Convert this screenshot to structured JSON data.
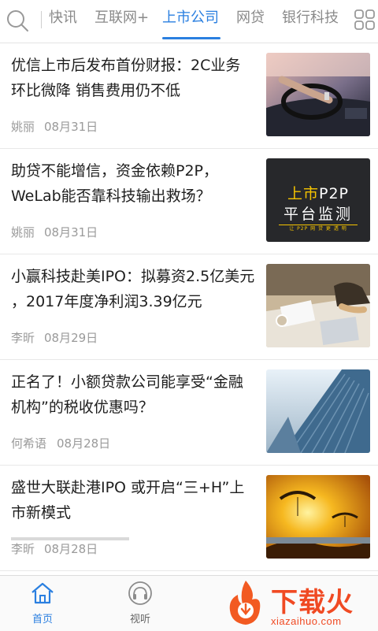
{
  "nav": {
    "tabs": [
      {
        "label": "快讯"
      },
      {
        "label": "互联网+"
      },
      {
        "label": "上市公司",
        "active": true
      },
      {
        "label": "网贷"
      },
      {
        "label": "银行科技"
      }
    ],
    "accent_color": "#2a7fe0",
    "search_icon": "search-icon",
    "more_icon": "grid-icon"
  },
  "articles": [
    {
      "title": "优信上市后发布首份财报：2C业务环比微降 销售费用仍不低",
      "author": "姚丽",
      "date": "08月31日",
      "thumb": "car-dashboard"
    },
    {
      "title": "助贷不能增信，资金依赖P2P，WeLab能否靠科技输出救场？",
      "author": "姚丽",
      "date": "08月31日",
      "thumb": "text-graphic",
      "thumb_text": {
        "highlight": "上市",
        "line1_rest": "P2P",
        "line2": "平台监测",
        "footer": "让 P2P 网 贷 更 透 明"
      }
    },
    {
      "title": "小赢科技赴美IPO：拟募资2.5亿美元 ，2017年度净利润3.39亿元",
      "author": "李昕",
      "date": "08月29日",
      "thumb": "office-desk"
    },
    {
      "title": "正名了！小额贷款公司能享受“金融机构”的税收优惠吗？",
      "author": "何希语",
      "date": "08月28日",
      "thumb": "skyscraper"
    },
    {
      "title": "盛世大联赴港IPO  或开启“三+H”上市新模式",
      "author": "李昕",
      "date": "08月28日",
      "thumb": "paragliders-sunset"
    }
  ],
  "bottom_nav": {
    "home_label": "首页",
    "listen_label": "视听"
  },
  "watermark": {
    "text": "下载火",
    "sub": "xiazaihuo.com"
  }
}
